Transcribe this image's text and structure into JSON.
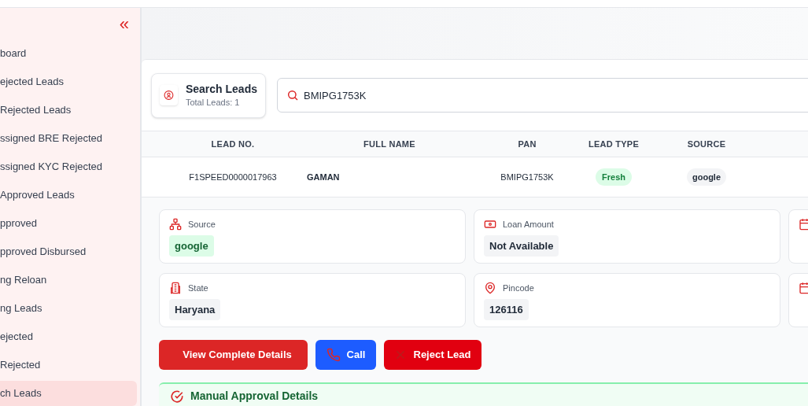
{
  "sidebar": {
    "collapse_icon": "«",
    "items": [
      {
        "label": "board",
        "selected": false
      },
      {
        "label": "ejected Leads",
        "selected": false
      },
      {
        "label": "Rejected Leads",
        "selected": false
      },
      {
        "label": "ssigned BRE Rejected",
        "selected": false
      },
      {
        "label": "ssigned KYC Rejected",
        "selected": false
      },
      {
        "label": "Approved Leads",
        "selected": false
      },
      {
        "label": "pproved",
        "selected": false
      },
      {
        "label": "pproved Disbursed",
        "selected": false
      },
      {
        "label": "ng Reloan",
        "selected": false
      },
      {
        "label": "ng Leads",
        "selected": false
      },
      {
        "label": "ejected",
        "selected": false
      },
      {
        "label": "Rejected",
        "selected": false
      },
      {
        "label": "ch Leads",
        "selected": true
      }
    ]
  },
  "search_card": {
    "title": "Search Leads",
    "subtitle": "Total Leads: 1"
  },
  "search": {
    "value": "BMIPG1753K"
  },
  "table": {
    "columns": [
      "LEAD NO.",
      "FULL NAME",
      "PAN",
      "LEAD TYPE",
      "SOURCE"
    ],
    "rows": [
      {
        "lead_no": "F1SPEED0000017963",
        "full_name": "GAMAN",
        "pan": "BMIPG1753K",
        "lead_type": "Fresh",
        "source": "google"
      }
    ]
  },
  "details": [
    {
      "kind": "source",
      "label": "Source",
      "value": "google"
    },
    {
      "kind": "money",
      "label": "Loan Amount",
      "value": "Not Available"
    },
    {
      "kind": "calendar"
    },
    {
      "kind": "building",
      "label": "State",
      "value": "Haryana"
    },
    {
      "kind": "pin",
      "label": "Pincode",
      "value": "126116"
    },
    {
      "kind": "calendar"
    }
  ],
  "buttons": [
    {
      "kind": "details",
      "label": "View Complete Details"
    },
    {
      "kind": "call",
      "label": "Call"
    },
    {
      "kind": "reject",
      "label": "Reject Lead"
    }
  ],
  "manual_approval": {
    "title": "Manual Approval Details"
  }
}
